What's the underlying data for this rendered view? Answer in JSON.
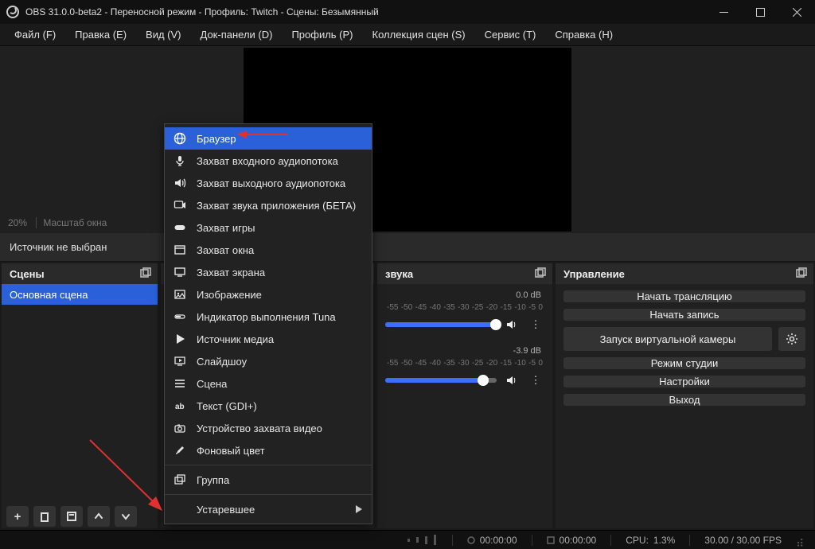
{
  "titlebar": {
    "title": "OBS 31.0.0-beta2 - Переносной режим - Профиль: Twitch - Сцены: Безымянный"
  },
  "menubar": {
    "items": [
      "Файл (F)",
      "Правка (E)",
      "Вид (V)",
      "Док-панели (D)",
      "Профиль (P)",
      "Коллекция сцен (S)",
      "Сервис (T)",
      "Справка (H)"
    ]
  },
  "preview": {
    "zoom": "20%",
    "scale_label": "Масштаб окна"
  },
  "no_source": "Источник не выбран",
  "scenes": {
    "title": "Сцены",
    "items": [
      "Основная сцена"
    ]
  },
  "mixer": {
    "title": "звука",
    "channels": [
      {
        "db": "0.0 dB",
        "fill_pct": 100,
        "thumb_pct": 99,
        "ticks": [
          "-55",
          "-50",
          "-45",
          "-40",
          "-35",
          "-30",
          "-25",
          "-20",
          "-15",
          "-10",
          "-5",
          "0"
        ]
      },
      {
        "db": "-3.9 dB",
        "fill_pct": 88,
        "thumb_pct": 88,
        "ticks": [
          "-55",
          "-50",
          "-45",
          "-40",
          "-35",
          "-30",
          "-25",
          "-20",
          "-15",
          "-10",
          "-5",
          "0"
        ]
      }
    ]
  },
  "controls": {
    "title": "Управление",
    "buttons": {
      "start_stream": "Начать трансляцию",
      "start_record": "Начать запись",
      "virtual_cam": "Запуск виртуальной камеры",
      "studio_mode": "Режим студии",
      "settings": "Настройки",
      "exit": "Выход"
    }
  },
  "status": {
    "rec_time": "00:00:00",
    "live_time": "00:00:00",
    "cpu_label": "CPU:",
    "cpu_value": "1.3%",
    "fps": "30.00 / 30.00 FPS"
  },
  "context_menu": {
    "items": [
      {
        "label": "Браузер",
        "icon": "globe",
        "selected": true
      },
      {
        "label": "Захват входного аудиопотока",
        "icon": "mic"
      },
      {
        "label": "Захват выходного аудиопотока",
        "icon": "speaker"
      },
      {
        "label": "Захват звука приложения (БЕТА)",
        "icon": "app-audio"
      },
      {
        "label": "Захват игры",
        "icon": "gamepad"
      },
      {
        "label": "Захват окна",
        "icon": "window"
      },
      {
        "label": "Захват экрана",
        "icon": "screen"
      },
      {
        "label": "Изображение",
        "icon": "image"
      },
      {
        "label": "Индикатор выполнения Tuna",
        "icon": "progress"
      },
      {
        "label": "Источник медиа",
        "icon": "play"
      },
      {
        "label": "Слайдшоу",
        "icon": "slideshow"
      },
      {
        "label": "Сцена",
        "icon": "scene"
      },
      {
        "label": "Текст (GDI+)",
        "icon": "text"
      },
      {
        "label": "Устройство захвата видео",
        "icon": "camera"
      },
      {
        "label": "Фоновый цвет",
        "icon": "brush"
      },
      {
        "label": "__sep__"
      },
      {
        "label": "Группа",
        "icon": "group"
      },
      {
        "label": "__sep__"
      },
      {
        "label": "Устаревшее",
        "icon": "",
        "submenu": true
      }
    ]
  }
}
